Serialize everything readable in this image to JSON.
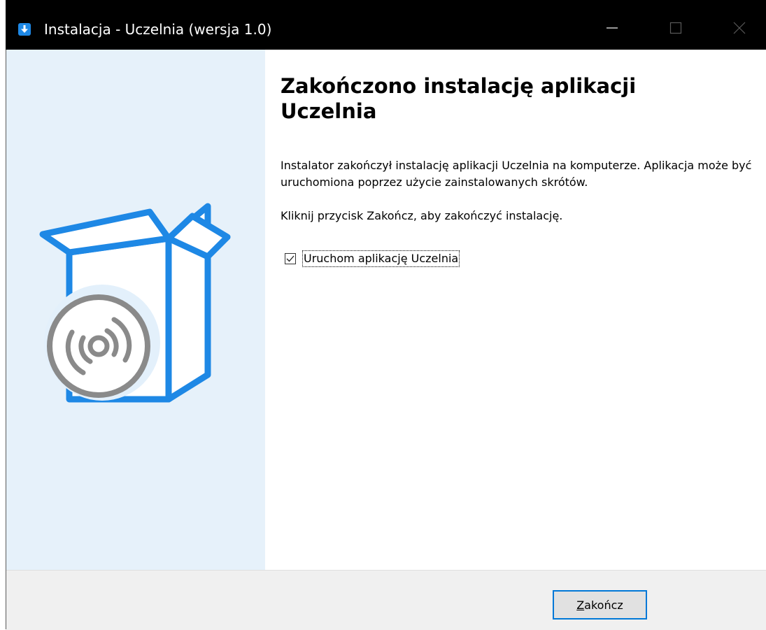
{
  "window": {
    "title": "Instalacja - Uczelnia (wersja 1.0)"
  },
  "icons": {
    "app": "installer-download-icon",
    "minimize": "minimize-icon",
    "maximize": "maximize-icon",
    "close": "close-icon",
    "illustration": "software-box-with-disc-illustration"
  },
  "page": {
    "heading": "Zakończono instalację aplikacji Uczelnia",
    "paragraph1": "Instalator zakończył instalację aplikacji Uczelnia na komputerze. Aplikacja może być uruchomiona poprzez użycie zainstalowanych skrótów.",
    "paragraph2": "Kliknij przycisk Zakończ, aby zakończyć instalację.",
    "launch_checkbox": {
      "label": "Uruchom aplikację Uczelnia",
      "checked": true
    }
  },
  "footer": {
    "finish_button": {
      "mnemonic": "Z",
      "rest": "akończ"
    }
  },
  "colors": {
    "accent": "#0078d7",
    "sidebar_bg": "#e6f1fa",
    "illustration_blue": "#1e88e5",
    "illustration_gray": "#8a8a8a"
  }
}
